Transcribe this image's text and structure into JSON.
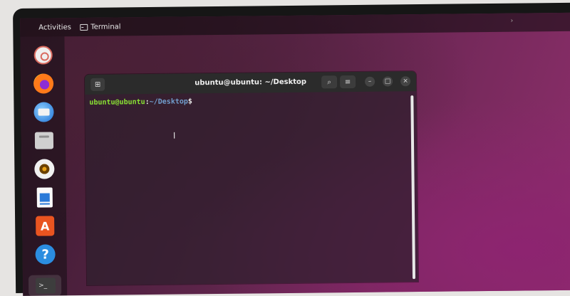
{
  "topbar": {
    "activities": "Activities",
    "app_menu_label": "Terminal",
    "app_menu_icon": "terminal-app-icon",
    "right_chevron": "›"
  },
  "dock": {
    "items": [
      {
        "name": "rescue-icon"
      },
      {
        "name": "firefox-icon"
      },
      {
        "name": "thunderbird-icon"
      },
      {
        "name": "files-icon"
      },
      {
        "name": "rhythmbox-icon"
      },
      {
        "name": "libreoffice-writer-icon"
      },
      {
        "name": "app-center-icon",
        "glyph": "A"
      },
      {
        "name": "help-icon",
        "glyph": "?"
      },
      {
        "name": "terminal-icon",
        "glyph": ">_"
      }
    ]
  },
  "terminal": {
    "title": "ubuntu@ubuntu: ~/Desktop",
    "newtab_glyph": "⊞",
    "search_glyph": "⌕",
    "menu_glyph": "≡",
    "minimize_glyph": "–",
    "maximize_glyph": "□",
    "close_glyph": "×",
    "prompt": {
      "user": "ubuntu@ubuntu",
      "sep": ":",
      "path": "~/Desktop",
      "dollar": "$"
    },
    "cursor_glyph": "I"
  },
  "colors": {
    "prompt_user": "#8ae234",
    "prompt_path": "#729fcf",
    "app_center": "#e95420",
    "help": "#2b8de0"
  }
}
